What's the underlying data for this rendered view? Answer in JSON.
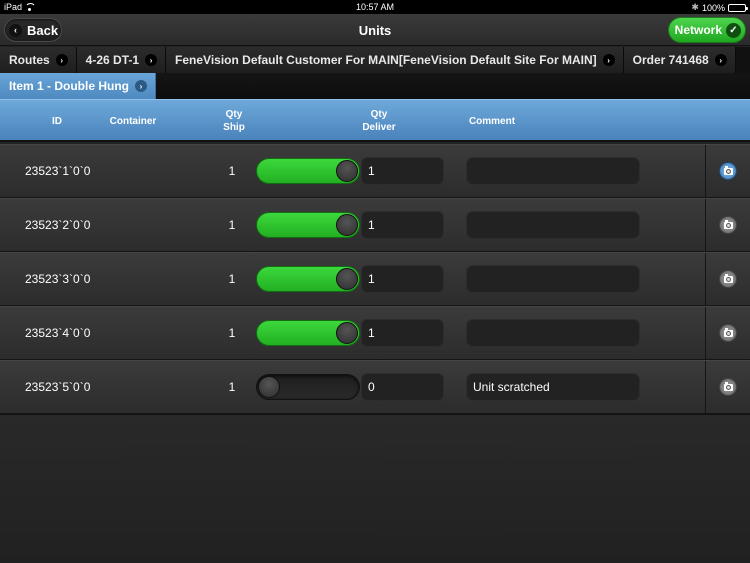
{
  "status_bar": {
    "device": "iPad",
    "time": "10:57 AM",
    "battery": "100%"
  },
  "nav": {
    "back_label": "Back",
    "title": "Units",
    "network_label": "Network",
    "network_status": "connected"
  },
  "breadcrumbs": [
    {
      "label": "Routes"
    },
    {
      "label": "4-26 DT-1"
    },
    {
      "label": "FeneVision Default Customer For MAIN[FeneVision Default Site For MAIN]"
    },
    {
      "label": "Order 741468"
    }
  ],
  "breadcrumb_active": {
    "label": "Item 1 - Double Hung"
  },
  "table": {
    "headers": {
      "id": "ID",
      "container": "Container",
      "qty_ship_1": "Qty",
      "qty_ship_2": "Ship",
      "qty_deliver_1": "Qty",
      "qty_deliver_2": "Deliver",
      "comment": "Comment"
    },
    "rows": [
      {
        "id": "23523`1`0`0",
        "container": "",
        "qty_ship": "1",
        "delivered": true,
        "qty_deliver": "1",
        "comment": "",
        "photo_selected": true
      },
      {
        "id": "23523`2`0`0",
        "container": "",
        "qty_ship": "1",
        "delivered": true,
        "qty_deliver": "1",
        "comment": "",
        "photo_selected": false
      },
      {
        "id": "23523`3`0`0",
        "container": "",
        "qty_ship": "1",
        "delivered": true,
        "qty_deliver": "1",
        "comment": "",
        "photo_selected": false
      },
      {
        "id": "23523`4`0`0",
        "container": "",
        "qty_ship": "1",
        "delivered": true,
        "qty_deliver": "1",
        "comment": "",
        "photo_selected": false
      },
      {
        "id": "23523`5`0`0",
        "container": "",
        "qty_ship": "1",
        "delivered": false,
        "qty_deliver": "0",
        "comment": "Unit scratched",
        "photo_selected": false
      }
    ]
  },
  "colors": {
    "accent_blue": "#5a93c9",
    "toggle_green": "#2fc42f",
    "network_green": "#34c234"
  }
}
